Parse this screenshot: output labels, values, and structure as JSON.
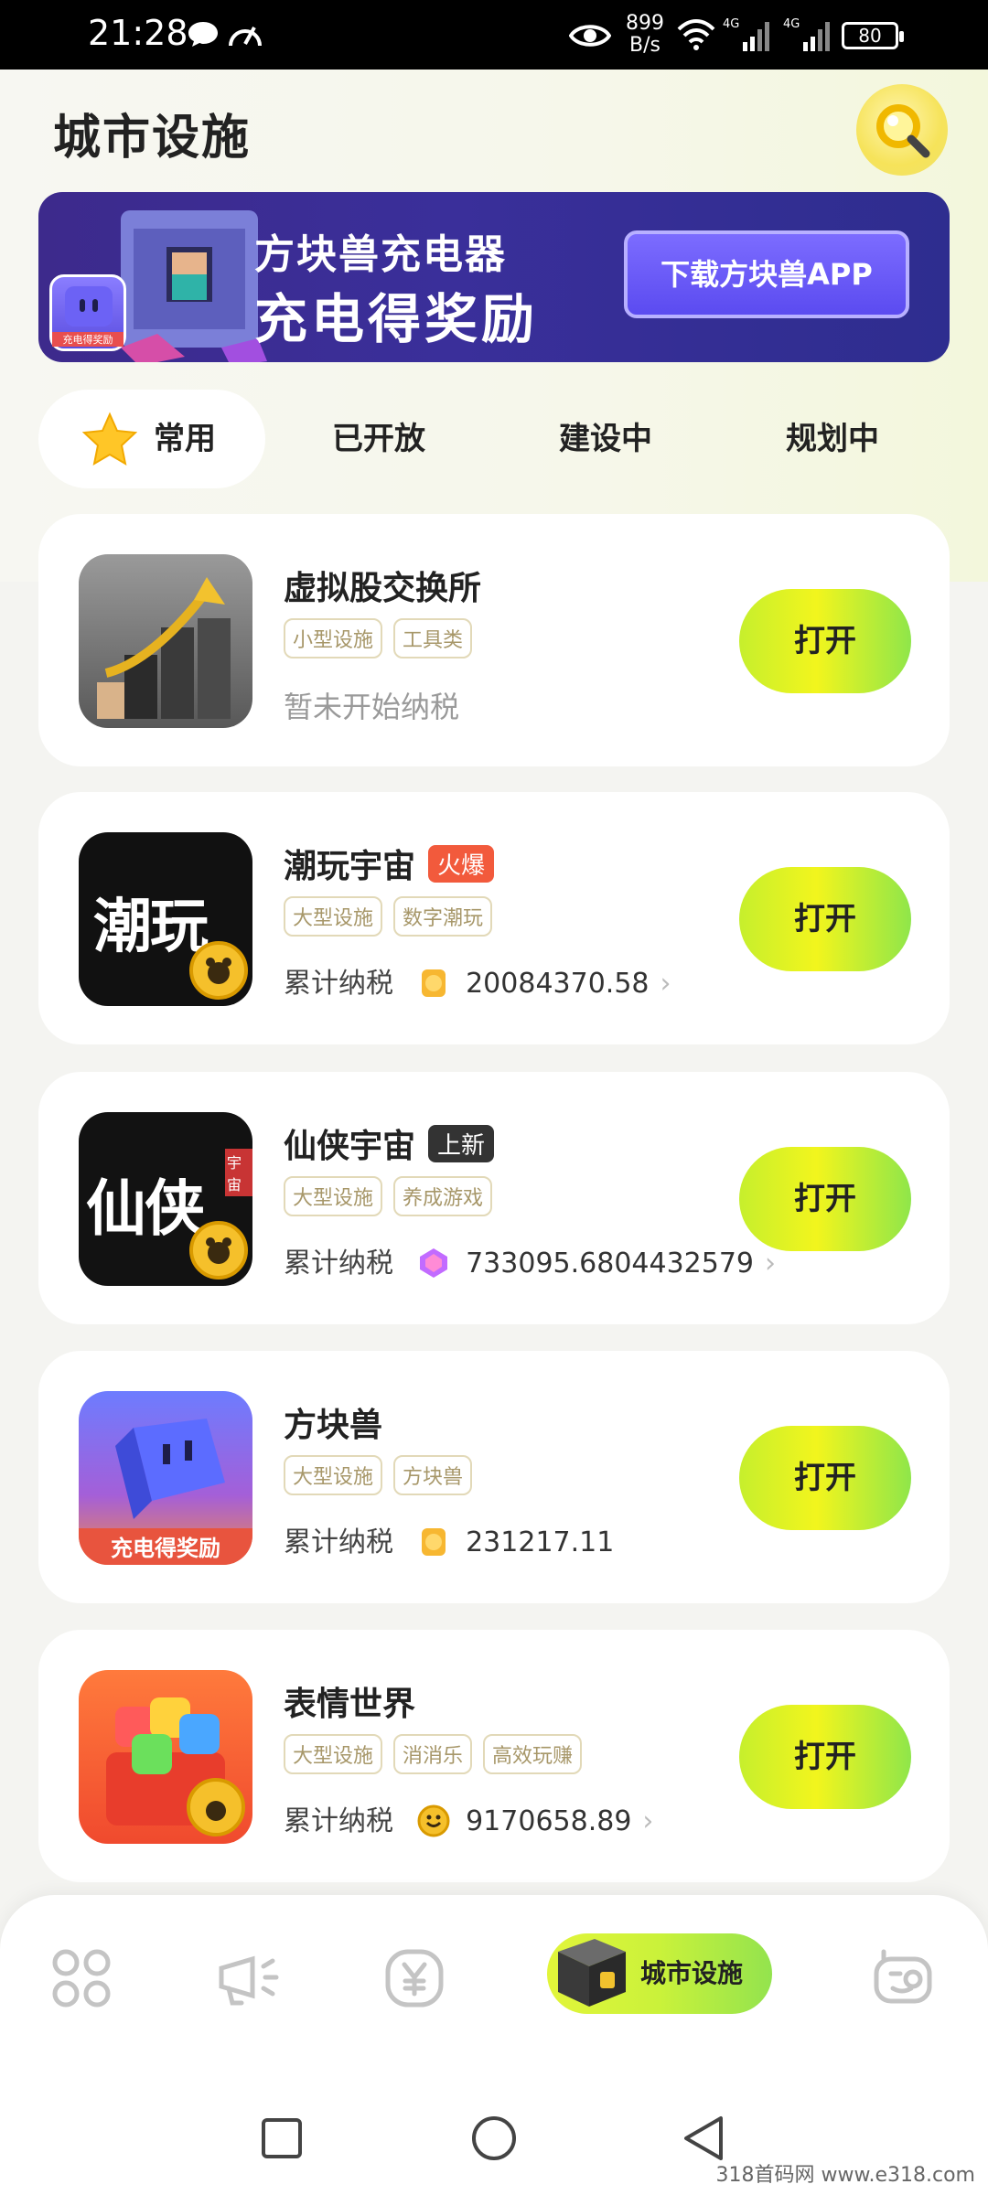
{
  "status_bar": {
    "time": "21:28",
    "net_rate_top": "899",
    "net_rate_bottom": "B/s",
    "sig1_label": "4G",
    "sig2_label": "4G",
    "battery": "80"
  },
  "header": {
    "title": "城市设施"
  },
  "banner": {
    "title": "方块兽充电器",
    "subtitle": "充电得奖励",
    "app_label": "充电得奖励",
    "button": "下载方块兽APP"
  },
  "tabs": [
    {
      "label": "常用",
      "active": true
    },
    {
      "label": "已开放"
    },
    {
      "label": "建设中"
    },
    {
      "label": "规划中"
    }
  ],
  "facilities": [
    {
      "name": "虚拟股交换所",
      "tags": [
        "小型设施",
        "工具类"
      ],
      "status": "暂未开始纳税",
      "button": "打开"
    },
    {
      "name": "潮玩宇宙",
      "badge": "火爆",
      "badge_color": "#f25a3c",
      "icon_text": "潮玩",
      "tags": [
        "大型设施",
        "数字潮玩"
      ],
      "tax_label": "累计纳税",
      "tax_value": "20084370.58",
      "button": "打开"
    },
    {
      "name": "仙侠宇宙",
      "badge": "上新",
      "badge_color": "#333333",
      "icon_text": "仙侠",
      "icon_small": "宇宙",
      "tags": [
        "大型设施",
        "养成游戏"
      ],
      "tax_label": "累计纳税",
      "tax_value": "733095.6804432579",
      "button": "打开"
    },
    {
      "name": "方块兽",
      "icon_text": "充电得奖励",
      "tags": [
        "大型设施",
        "方块兽"
      ],
      "tax_label": "累计纳税",
      "tax_value": "231217.11",
      "button": "打开"
    },
    {
      "name": "表情世界",
      "tags": [
        "大型设施",
        "消消乐",
        "高效玩赚"
      ],
      "tax_label": "累计纳税",
      "tax_value": "9170658.89",
      "button": "打开"
    }
  ],
  "bottom_nav": {
    "items": [
      "home-grid",
      "broadcast",
      "yuan-coin",
      "city-facilities",
      "profile"
    ],
    "active_label": "城市设施"
  },
  "watermark": "318首码网 www.e318.com"
}
